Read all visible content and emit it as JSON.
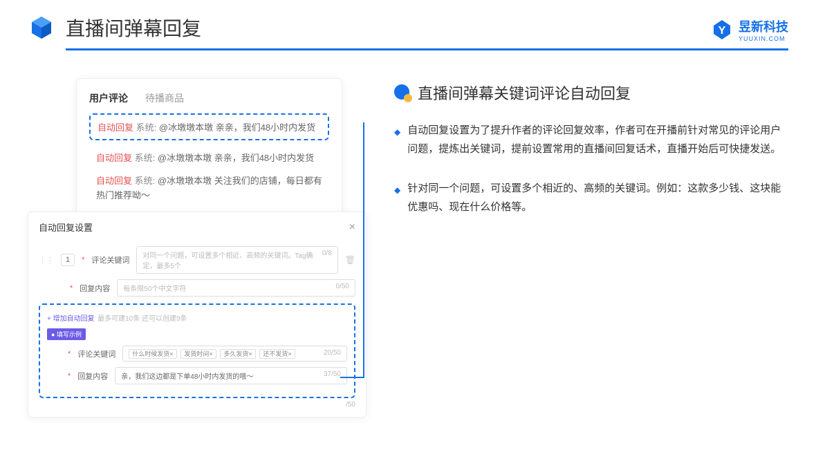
{
  "header": {
    "title": "直播间弹幕回复"
  },
  "logo": {
    "name": "昱新科技",
    "sub": "YUUXIN.COM"
  },
  "card1": {
    "tab1": "用户评论",
    "tab2": "待播商品",
    "highlight_prefix": "自动回复",
    "highlight_sys": "系统:",
    "highlight_text": "@冰墩墩本墩 亲亲，我们48小时内发货",
    "line2_prefix": "自动回复",
    "line2_sys": "系统:",
    "line2_text": "@冰墩墩本墩 亲亲，我们48小时内发货",
    "line3_prefix": "自动回复",
    "line3_sys": "系统:",
    "line3_text": "@冰墩墩本墩 关注我们的店铺，每日都有热门推荐呦～"
  },
  "card2": {
    "title": "自动回复设置",
    "num": "1",
    "label1": "评论关键词",
    "placeholder1": "对同一个问题，可设置多个相近、高频的关键词。Tag确定，最多5个",
    "counter1": "0/8",
    "label2": "回复内容",
    "placeholder2": "每条限50个中文字符",
    "counter2": "0/50",
    "add": "+ 增加自动回复",
    "hint": "最多可建10条 还可以创建9条",
    "badge": "● 填写示例",
    "ex_label1": "评论关键词",
    "tag1": "什么时候发货×",
    "tag2": "发货时间×",
    "tag3": "多久发货×",
    "tag4": "还不发货×",
    "ex_counter1": "20/50",
    "ex_label2": "回复内容",
    "ex_value": "亲，我们这边都是下单48小时内发货的哦～",
    "ex_counter2": "37/50",
    "bottom_counter": "/50"
  },
  "right": {
    "title": "直播间弹幕关键词评论自动回复",
    "b1": "自动回复设置为了提升作者的评论回复效率，作者可在开播前针对常见的评论用户问题，提炼出关键词，提前设置常用的直播间回复话术，直播开始后可快捷发送。",
    "b2": "针对同一个问题，可设置多个相近的、高频的关键词。例如：这款多少钱、这块能优惠吗、现在什么价格等。"
  }
}
